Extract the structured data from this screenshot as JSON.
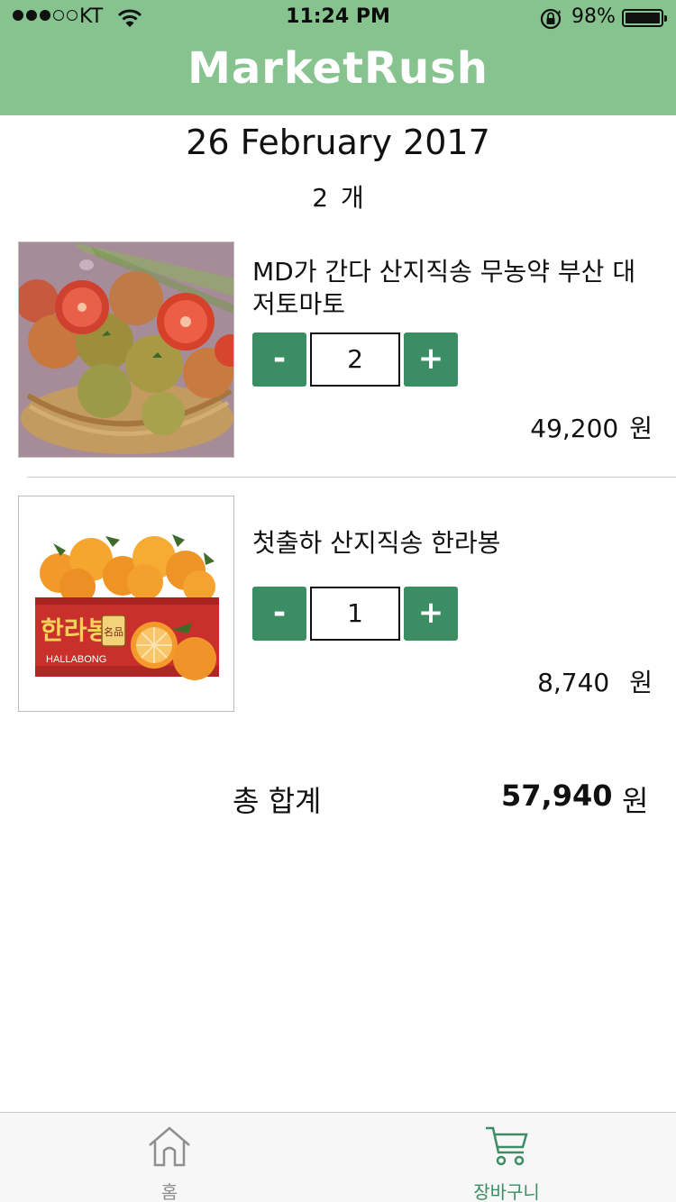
{
  "status_bar": {
    "carrier": "KT",
    "time": "11:24 PM",
    "battery": "98%"
  },
  "header": {
    "title": "MarketRush"
  },
  "cart": {
    "date": "26 February 2017",
    "count": "2",
    "count_unit": "개",
    "items": [
      {
        "name": "MD가 간다 산지직송 무농약 부산 대저토마토",
        "quantity": "2",
        "price": "49,200",
        "currency": "원",
        "minus": "-",
        "plus": "+"
      },
      {
        "name": "첫출하 산지직송 한라봉",
        "quantity": "1",
        "price": "8,740",
        "currency": "원",
        "minus": "-",
        "plus": "+"
      }
    ],
    "total_label": "총 합계",
    "total_value": "57,940",
    "total_currency": "원"
  },
  "product_images": {
    "hallabong_box_korean": "한라봉",
    "hallabong_box_english": "HALLABONG",
    "hallabong_seal": "名品"
  },
  "tabbar": {
    "home_label": "홈",
    "cart_label": "장바구니"
  },
  "colors": {
    "header_bg": "#86c38e",
    "accent": "#3b8e64",
    "tab_inactive": "#8e8e8e"
  }
}
